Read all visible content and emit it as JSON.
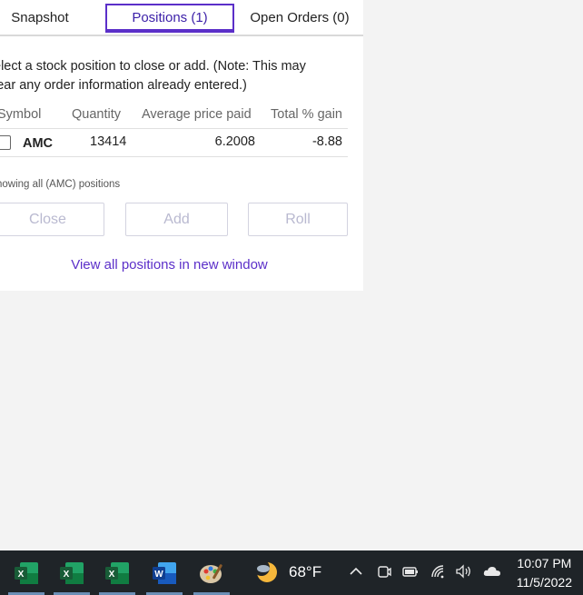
{
  "tabs": [
    {
      "label": "Snapshot"
    },
    {
      "label": "Positions (1)"
    },
    {
      "label": "Open Orders (0)"
    }
  ],
  "note_line1": "elect a stock position to close or add. (Note: This may",
  "note_line2": "lear any order information already entered.)",
  "table": {
    "headers": [
      "Symbol",
      "Quantity",
      "Average price paid",
      "Total % gain"
    ],
    "rows": [
      {
        "symbol": "AMC",
        "quantity": "13414",
        "avg_price": "6.2008",
        "gain": "-8.88"
      }
    ]
  },
  "showing_text": "howing all (AMC) positions",
  "buttons": {
    "close": "Close",
    "add": "Add",
    "roll": "Roll"
  },
  "link_text": "View all positions in new window",
  "taskbar": {
    "apps": [
      "excel-icon",
      "excel-icon",
      "excel-icon",
      "word-icon",
      "paint-icon"
    ],
    "weather_temp": "68°F",
    "time": "10:07 PM",
    "date": "11/5/2022"
  },
  "colors": {
    "accent": "#5b2fc9",
    "taskbar": "#1f2428"
  }
}
